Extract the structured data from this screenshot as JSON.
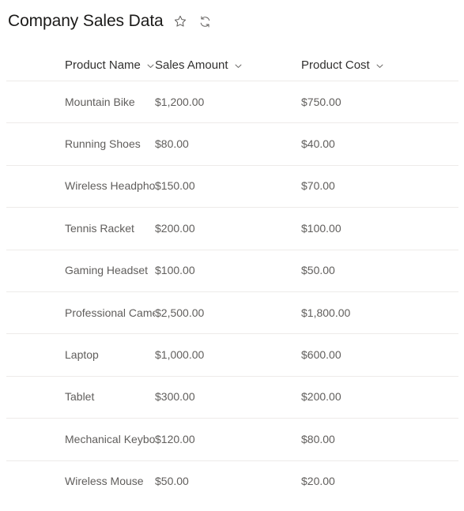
{
  "header": {
    "title": "Company Sales Data",
    "favorite_icon": "star-icon",
    "refresh_icon": "refresh-icon"
  },
  "list": {
    "columns": [
      {
        "label": "Product Name",
        "sort_icon": "chevron-down-icon"
      },
      {
        "label": "Sales Amount",
        "sort_icon": "chevron-down-icon"
      },
      {
        "label": "Product Cost",
        "sort_icon": "chevron-down-icon"
      }
    ],
    "rows": [
      {
        "product_name": "Mountain Bike",
        "sales_amount": "$1,200.00",
        "product_cost": "$750.00"
      },
      {
        "product_name": "Running Shoes",
        "sales_amount": "$80.00",
        "product_cost": "$40.00"
      },
      {
        "product_name": "Wireless Headphones",
        "sales_amount": "$150.00",
        "product_cost": "$70.00"
      },
      {
        "product_name": "Tennis Racket",
        "sales_amount": "$200.00",
        "product_cost": "$100.00"
      },
      {
        "product_name": "Gaming Headset",
        "sales_amount": "$100.00",
        "product_cost": "$50.00"
      },
      {
        "product_name": "Professional Camera",
        "sales_amount": "$2,500.00",
        "product_cost": "$1,800.00"
      },
      {
        "product_name": "Laptop",
        "sales_amount": "$1,000.00",
        "product_cost": "$600.00"
      },
      {
        "product_name": "Tablet",
        "sales_amount": "$300.00",
        "product_cost": "$200.00"
      },
      {
        "product_name": "Mechanical Keyboard",
        "sales_amount": "$120.00",
        "product_cost": "$80.00"
      },
      {
        "product_name": "Wireless Mouse",
        "sales_amount": "$50.00",
        "product_cost": "$20.00"
      }
    ]
  },
  "colors": {
    "title_text": "#1b1a19",
    "header_text": "#323130",
    "cell_text": "#605e5c",
    "divider": "#edebe9",
    "icon": "#605e5c",
    "background": "#ffffff"
  }
}
